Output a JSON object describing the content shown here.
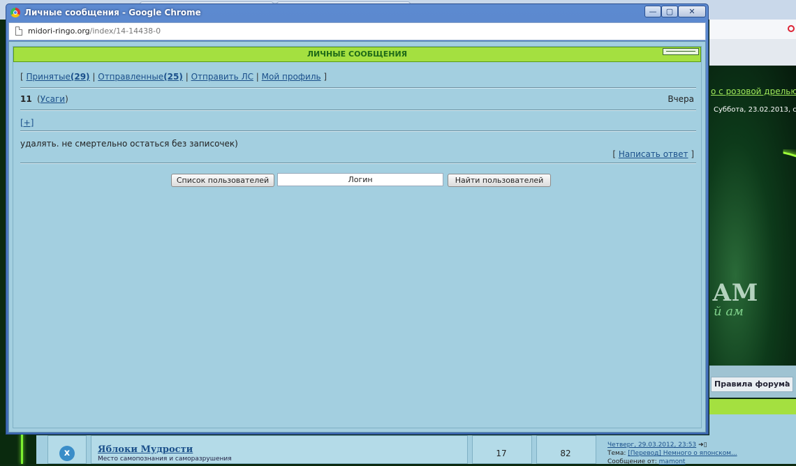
{
  "background": {
    "banner_link": "о с розовой дрелью\"",
    "banner_date": "Суббота, 23.02.2013, с",
    "banner_brand": "АМ",
    "banner_brand_sub": "й ам",
    "rules_label": "Правила форума",
    "nav_dot": "·",
    "forum_row": {
      "icon_glyph": "x",
      "title": "Яблоки Мудрости",
      "description": "Место самопознания и саморазрушения",
      "topics": "17",
      "posts": "82",
      "last_date": "Четверг, 29.03.2012, 23:53",
      "last_topic_label": "Тема:",
      "last_topic": "[Перевод] Немного о японском...",
      "last_author_label": "Сообщение от:",
      "last_author": "mamont"
    }
  },
  "window": {
    "title": "Личные сообщения - Google Chrome",
    "minimize": "—",
    "maximize": "▢",
    "close": "✕",
    "url_host": "midori-ringo.org",
    "url_path": "/index/14-14438-0"
  },
  "page": {
    "header": "ЛИЧНЫЕ СООБЩЕНИЯ",
    "nav": {
      "open": "[",
      "inbox": "Принятые",
      "inbox_count": "(29)",
      "sep1": "|",
      "sent": "Отправленные",
      "sent_count": "(25)",
      "sep2": "|",
      "send": "Отправить ЛС",
      "sep3": "|",
      "profile": "Мой профиль",
      "close": "]"
    },
    "message": {
      "number": "11",
      "paren_open": "(",
      "sender": "Усаги",
      "paren_close": ")",
      "date": "Вчера",
      "expand": "[+]",
      "text": "удалять. не смертельно остаться без записочек)",
      "reply_open": "[",
      "reply": "Написать ответ",
      "reply_close": "]"
    },
    "search": {
      "list_button": "Список пользователей",
      "login_value": "Логин",
      "find_button": "Найти пользователей"
    }
  }
}
